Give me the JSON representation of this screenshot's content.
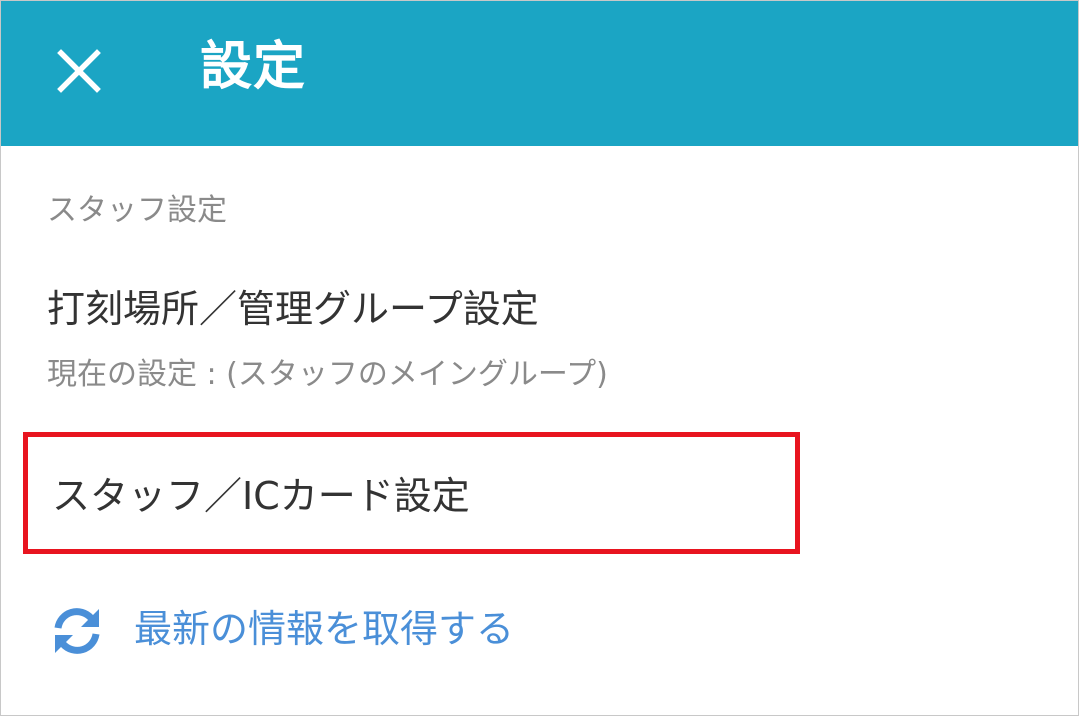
{
  "header": {
    "title": "設定",
    "close_icon": "close-icon",
    "background_color": "#1ba5c4"
  },
  "section": {
    "title": "スタッフ設定"
  },
  "menu": {
    "item1": {
      "label": "打刻場所／管理グループ設定",
      "sublabel": "現在の設定 : (スタッフのメイングループ)"
    },
    "item2": {
      "label": "スタッフ／ICカード設定",
      "highlight_color": "#e8141f"
    }
  },
  "refresh": {
    "label": "最新の情報を取得する",
    "icon": "refresh-icon",
    "color": "#4a8fd8"
  }
}
